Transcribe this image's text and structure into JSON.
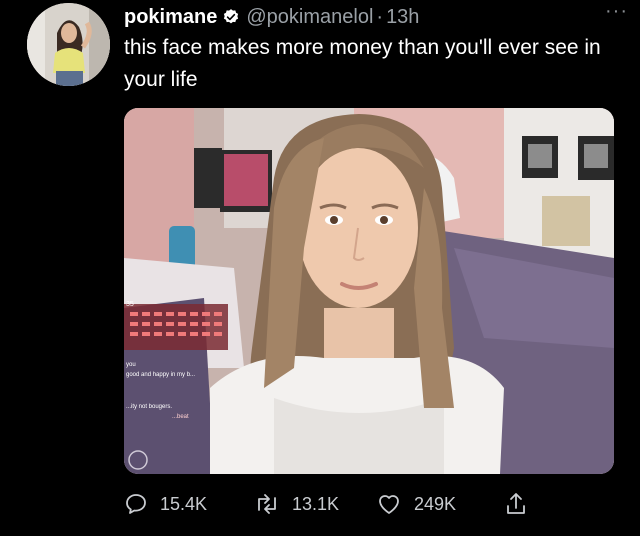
{
  "tweet": {
    "display_name": "pokimane",
    "handle": "@pokimanelol",
    "separator": "·",
    "time": "13h",
    "text": "this face makes more money than you'll ever see in your life",
    "more_glyph": "···"
  },
  "media": {
    "overlay_text": {
      "count": "35",
      "line1": "you",
      "line2": "good and happy in my b...",
      "line3": "...ity not bougers.",
      "line4": "...beat"
    }
  },
  "actions": {
    "reply_icon": "reply-icon",
    "reply_count": "15.4K",
    "retweet_icon": "retweet-icon",
    "retweet_count": "13.1K",
    "like_icon": "heart-icon",
    "like_count": "249K",
    "share_icon": "share-icon"
  },
  "colors": {
    "background": "#000000",
    "text": "#ffffff",
    "muted": "#9aa0a6",
    "verified": "#ffffff"
  }
}
